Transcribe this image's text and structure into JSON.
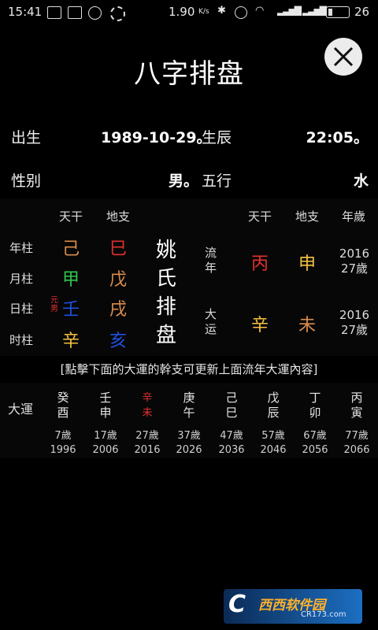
{
  "status": {
    "time": "15:41",
    "speed": "1.90",
    "speed_unit": "K/s",
    "battery": "26"
  },
  "header": {
    "title": "八字排盘"
  },
  "info": {
    "birth_label": "出生",
    "birth_date": "1989-10-29。",
    "hour_label": "生辰",
    "hour_value": "22:05。",
    "gender_label": "性别",
    "gender_value": "男。",
    "element_label": "五行",
    "element_value": "水"
  },
  "pillars": {
    "col_gan": "天干",
    "col_zhi": "地支",
    "rows": [
      {
        "label": "年柱",
        "gan": "己",
        "zhi": "巳"
      },
      {
        "label": "月柱",
        "gan": "甲",
        "zhi": "戊"
      },
      {
        "label": "日柱",
        "gan": "壬",
        "zhi": "戌",
        "tag": "元男"
      },
      {
        "label": "时柱",
        "gan": "辛",
        "zhi": "亥"
      }
    ]
  },
  "center_title": [
    "姚",
    "氏",
    "排",
    "盘"
  ],
  "liunian": {
    "col_gan": "天干",
    "col_zhi": "地支",
    "col_year": "年歲",
    "rows": [
      {
        "label1": "流",
        "label2": "年",
        "gan": "丙",
        "zhi": "申",
        "year": "2016",
        "age": "27歲"
      },
      {
        "label1": "大",
        "label2": "运",
        "gan": "辛",
        "zhi": "未",
        "year": "2016",
        "age": "27歲"
      }
    ]
  },
  "notice": "[點擊下面的大運的幹支可更新上面流年大運內容]",
  "dayun": {
    "label": "大運",
    "items": [
      {
        "gan": "癸",
        "zhi": "酉",
        "age": "7歲",
        "year": "1996"
      },
      {
        "gan": "壬",
        "zhi": "申",
        "age": "17歲",
        "year": "2006"
      },
      {
        "gan": "辛",
        "zhi": "未",
        "age": "27歲",
        "year": "2016",
        "selected": true
      },
      {
        "gan": "庚",
        "zhi": "午",
        "age": "37歲",
        "year": "2026"
      },
      {
        "gan": "己",
        "zhi": "巳",
        "age": "47歲",
        "year": "2036"
      },
      {
        "gan": "戊",
        "zhi": "辰",
        "age": "57歲",
        "year": "2046"
      },
      {
        "gan": "丁",
        "zhi": "卯",
        "age": "67歲",
        "year": "2056"
      },
      {
        "gan": "丙",
        "zhi": "寅",
        "age": "77歲",
        "year": "2066"
      }
    ]
  },
  "watermark": {
    "brand": "西西软件园",
    "url": "CR173.com"
  },
  "colors": {
    "earth": "#d98c4c",
    "fire": "#e0312f",
    "wood": "#2fc84a",
    "water": "#2050e0",
    "metal": "#f5c242",
    "selected": "#e0312f"
  }
}
